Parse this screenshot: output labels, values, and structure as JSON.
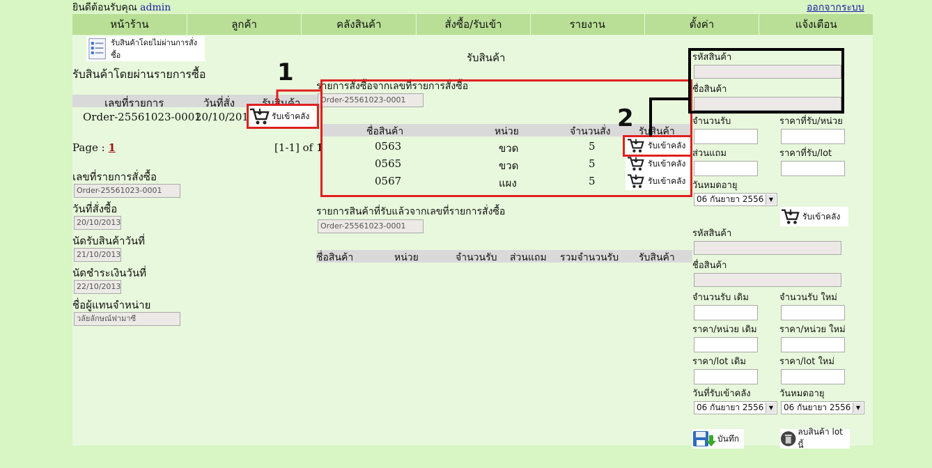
{
  "header": {
    "welcome": "ยินดีต้อนรับคุณ",
    "user": "admin",
    "logout": "ออกจากระบบ"
  },
  "menu": [
    {
      "label": "หน้าร้าน"
    },
    {
      "label": "ลูกค้า"
    },
    {
      "label": "คลังสินค้า"
    },
    {
      "label": "สั่งซื้อ/รับเข้า"
    },
    {
      "label": "รายงาน"
    },
    {
      "label": "ตั้งค่า"
    },
    {
      "label": "แจ้งเตือน"
    }
  ],
  "left": {
    "no_po_button": "รับสินค้าโดยไม่ผ่านการสั่งซื้อ",
    "section_title": "รับสินค้าโดยผ่านรายการซื้อ",
    "cols": {
      "order_no": "เลขที่รายการ",
      "order_date": "วันที่สั่ง",
      "receive": "รับสินค้า"
    },
    "row": {
      "order_no": "Order-25561023-0001",
      "order_date": "20/10/2013",
      "receive_button": "รับเข้าคลัง"
    },
    "page_label": "Page :",
    "page_num": "1",
    "range": "[1-1] of",
    "total": "1",
    "form": {
      "order_no_label": "เลขที่รายการสั่งซื้อ",
      "order_no_value": "Order-25561023-0001",
      "order_date_label": "วันที่สั่งซื้อ",
      "order_date_value": "20/10/2013",
      "receive_date_label": "นัดรับสินค้าวันที่",
      "receive_date_value": "21/10/2013",
      "pay_date_label": "นัดชำระเงินวันที่",
      "pay_date_value": "22/10/2013",
      "rep_label": "ชื่อผู้แทนจำหน่าย",
      "rep_value": "วลัยลักษณ์ฟามาซี"
    }
  },
  "center": {
    "title": "รับสินค้า",
    "po_list_label": "รายการสั่งซื้อจากเลขที่รายการสั่งซื้อ",
    "po_list_value": "Order-25561023-0001",
    "cols": {
      "name": "ชื่อสินค้า",
      "unit": "หน่วย",
      "qty": "จำนวนสั่ง",
      "receive": "รับสินค้า"
    },
    "rows": [
      {
        "name": "0563",
        "unit": "ขวด",
        "qty": "5",
        "button": "รับเข้าคลัง"
      },
      {
        "name": "0565",
        "unit": "ขวด",
        "qty": "5",
        "button": "รับเข้าคลัง"
      },
      {
        "name": "0567",
        "unit": "แผง",
        "qty": "5",
        "button": "รับเข้าคลัง"
      }
    ],
    "received_label": "รายการสินค้าที่รับแล้วจากเลขที่รายการสั่งซื้อ",
    "received_value": "Order-25561023-0001",
    "received_cols": {
      "name": "ชื่อสินค้า",
      "unit": "หน่วย",
      "qty_received": "จำนวนรับ",
      "bonus": "ส่วนแถม",
      "total": "รวมจำนวนรับ",
      "receive": "รับสินค้า"
    }
  },
  "annotations": {
    "one": "1",
    "two": "2"
  },
  "right": {
    "code_label": "รหัสสินค้า",
    "name_label": "ชื่อสินค้า",
    "qty_label": "จำนวนรับ",
    "price_unit_label": "ราคาที่รับ/หน่วย",
    "bonus_label": "ส่วนแถม",
    "price_lot_label": "ราคาที่รับ/lot",
    "expiry_label": "วันหมดอายุ",
    "expiry_value": "06 กันยายา 2556",
    "receive_button": "รับเข้าคลัง",
    "edit": {
      "code_label": "รหัสสินค้า",
      "name_label": "ชื่อสินค้า",
      "qty_old": "จำนวนรับ เดิม",
      "qty_new": "จำนวนรับ ใหม่",
      "price_unit_old": "ราคา/หน่วย เดิม",
      "price_unit_new": "ราคา/หน่วย ใหม่",
      "price_lot_old": "ราคา/lot เดิม",
      "price_lot_new": "ราคา/lot ใหม่",
      "receive_date_label": "วันที่รับเข้าคลัง",
      "expiry_label": "วันหมดอายุ",
      "receive_date_value": "06 กันยายา 2556",
      "expiry_value": "06 กันยายา 2556",
      "save_button": "บันทึก",
      "delete_button": "ลบสินค้า lot นี้"
    }
  }
}
